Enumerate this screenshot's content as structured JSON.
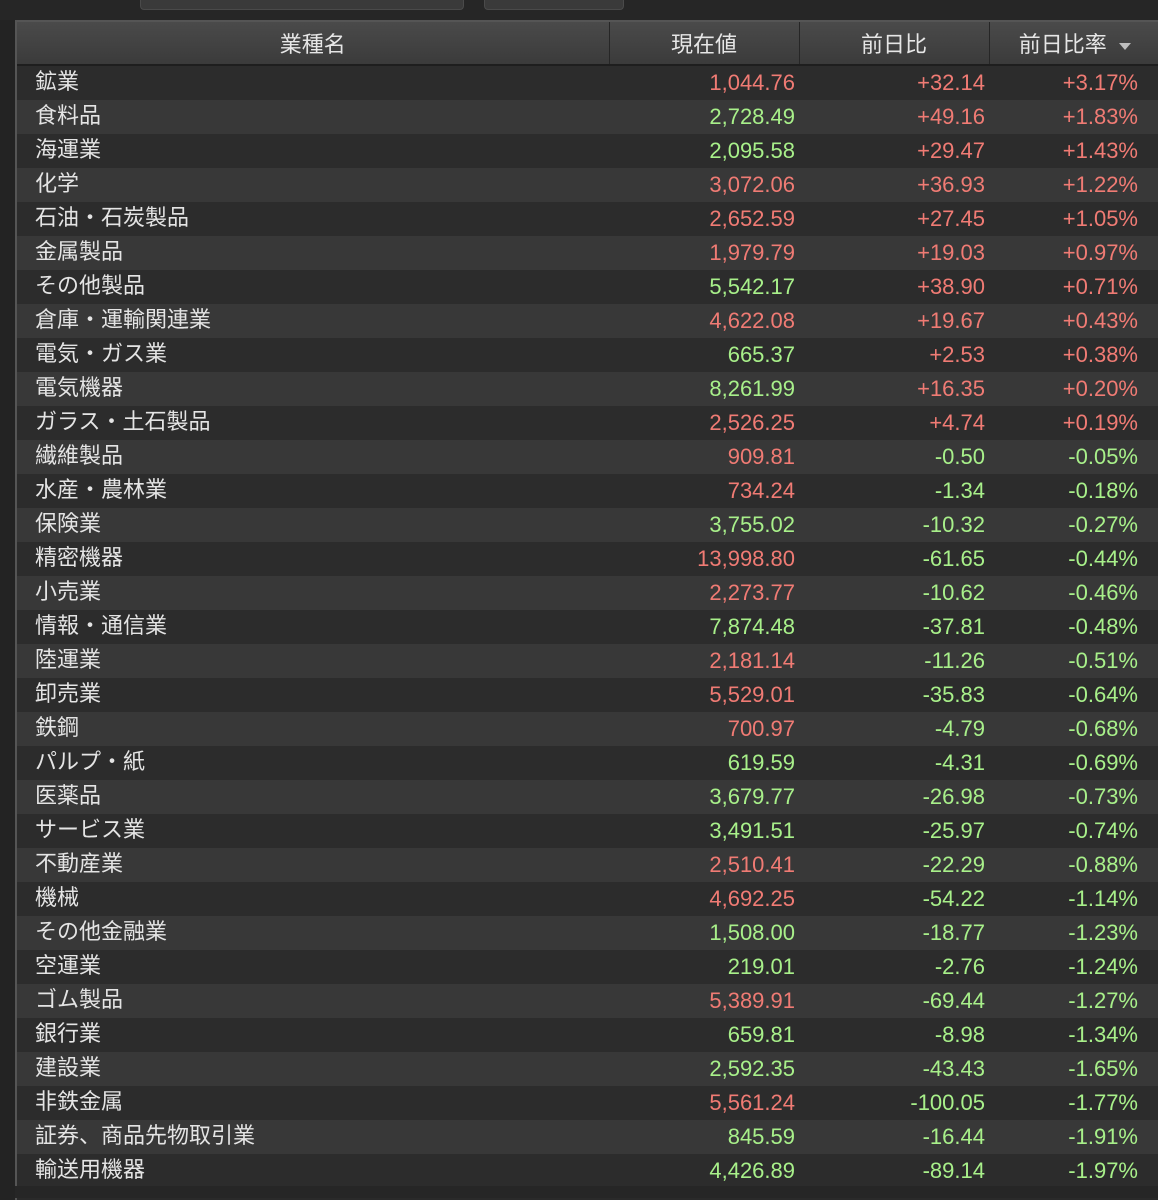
{
  "colors": {
    "up": "#f07b74",
    "down": "#a8f08a",
    "background": "#2a2a2a",
    "row_alt": "#383838",
    "header": "#424242"
  },
  "table": {
    "headers": [
      "業種名",
      "現在値",
      "前日比",
      "前日比率"
    ],
    "sort_icon": "chevron-down-icon",
    "rows": [
      {
        "name": "鉱業",
        "price": "1,044.76",
        "change": "+32.14",
        "pct": "+3.17%",
        "price_color": "up"
      },
      {
        "name": "食料品",
        "price": "2,728.49",
        "change": "+49.16",
        "pct": "+1.83%",
        "price_color": "down"
      },
      {
        "name": "海運業",
        "price": "2,095.58",
        "change": "+29.47",
        "pct": "+1.43%",
        "price_color": "down"
      },
      {
        "name": "化学",
        "price": "3,072.06",
        "change": "+36.93",
        "pct": "+1.22%",
        "price_color": "up"
      },
      {
        "name": "石油・石炭製品",
        "price": "2,652.59",
        "change": "+27.45",
        "pct": "+1.05%",
        "price_color": "up"
      },
      {
        "name": "金属製品",
        "price": "1,979.79",
        "change": "+19.03",
        "pct": "+0.97%",
        "price_color": "up"
      },
      {
        "name": "その他製品",
        "price": "5,542.17",
        "change": "+38.90",
        "pct": "+0.71%",
        "price_color": "down"
      },
      {
        "name": "倉庫・運輸関連業",
        "price": "4,622.08",
        "change": "+19.67",
        "pct": "+0.43%",
        "price_color": "up"
      },
      {
        "name": "電気・ガス業",
        "price": "665.37",
        "change": "+2.53",
        "pct": "+0.38%",
        "price_color": "down"
      },
      {
        "name": "電気機器",
        "price": "8,261.99",
        "change": "+16.35",
        "pct": "+0.20%",
        "price_color": "down"
      },
      {
        "name": "ガラス・土石製品",
        "price": "2,526.25",
        "change": "+4.74",
        "pct": "+0.19%",
        "price_color": "up"
      },
      {
        "name": "繊維製品",
        "price": "909.81",
        "change": "-0.50",
        "pct": "-0.05%",
        "price_color": "up"
      },
      {
        "name": "水産・農林業",
        "price": "734.24",
        "change": "-1.34",
        "pct": "-0.18%",
        "price_color": "up"
      },
      {
        "name": "保険業",
        "price": "3,755.02",
        "change": "-10.32",
        "pct": "-0.27%",
        "price_color": "down"
      },
      {
        "name": "精密機器",
        "price": "13,998.80",
        "change": "-61.65",
        "pct": "-0.44%",
        "price_color": "up"
      },
      {
        "name": "小売業",
        "price": "2,273.77",
        "change": "-10.62",
        "pct": "-0.46%",
        "price_color": "up"
      },
      {
        "name": "情報・通信業",
        "price": "7,874.48",
        "change": "-37.81",
        "pct": "-0.48%",
        "price_color": "down"
      },
      {
        "name": "陸運業",
        "price": "2,181.14",
        "change": "-11.26",
        "pct": "-0.51%",
        "price_color": "up"
      },
      {
        "name": "卸売業",
        "price": "5,529.01",
        "change": "-35.83",
        "pct": "-0.64%",
        "price_color": "up"
      },
      {
        "name": "鉄鋼",
        "price": "700.97",
        "change": "-4.79",
        "pct": "-0.68%",
        "price_color": "up"
      },
      {
        "name": "パルプ・紙",
        "price": "619.59",
        "change": "-4.31",
        "pct": "-0.69%",
        "price_color": "down"
      },
      {
        "name": "医薬品",
        "price": "3,679.77",
        "change": "-26.98",
        "pct": "-0.73%",
        "price_color": "down"
      },
      {
        "name": "サービス業",
        "price": "3,491.51",
        "change": "-25.97",
        "pct": "-0.74%",
        "price_color": "down"
      },
      {
        "name": "不動産業",
        "price": "2,510.41",
        "change": "-22.29",
        "pct": "-0.88%",
        "price_color": "up"
      },
      {
        "name": "機械",
        "price": "4,692.25",
        "change": "-54.22",
        "pct": "-1.14%",
        "price_color": "up"
      },
      {
        "name": "その他金融業",
        "price": "1,508.00",
        "change": "-18.77",
        "pct": "-1.23%",
        "price_color": "down"
      },
      {
        "name": "空運業",
        "price": "219.01",
        "change": "-2.76",
        "pct": "-1.24%",
        "price_color": "down"
      },
      {
        "name": "ゴム製品",
        "price": "5,389.91",
        "change": "-69.44",
        "pct": "-1.27%",
        "price_color": "up"
      },
      {
        "name": "銀行業",
        "price": "659.81",
        "change": "-8.98",
        "pct": "-1.34%",
        "price_color": "down"
      },
      {
        "name": "建設業",
        "price": "2,592.35",
        "change": "-43.43",
        "pct": "-1.65%",
        "price_color": "down"
      },
      {
        "name": "非鉄金属",
        "price": "5,561.24",
        "change": "-100.05",
        "pct": "-1.77%",
        "price_color": "up"
      },
      {
        "name": "証券、商品先物取引業",
        "price": "845.59",
        "change": "-16.44",
        "pct": "-1.91%",
        "price_color": "down"
      },
      {
        "name": "輸送用機器",
        "price": "4,426.89",
        "change": "-89.14",
        "pct": "-1.97%",
        "price_color": "down"
      }
    ]
  }
}
